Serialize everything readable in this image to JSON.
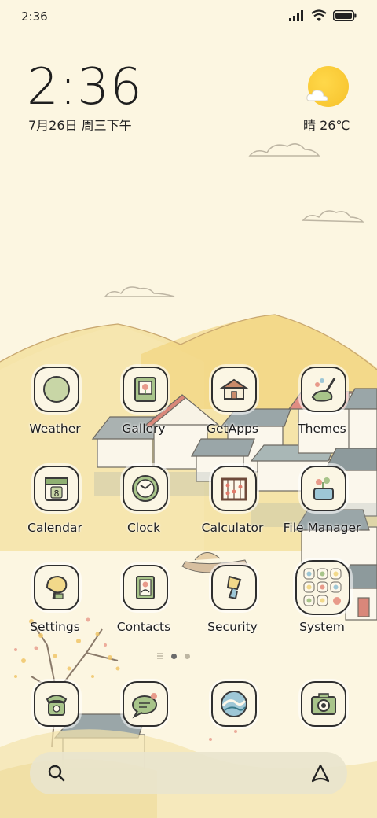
{
  "status_bar": {
    "time": "2:36"
  },
  "clock_widget": {
    "time": "2:36",
    "date": "7月26日 周三下午"
  },
  "weather_widget": {
    "condition_temp": "晴 26℃",
    "icon": "sun-cloud-icon"
  },
  "apps": [
    {
      "label": "Weather",
      "icon": "weather-icon"
    },
    {
      "label": "Gallery",
      "icon": "gallery-icon"
    },
    {
      "label": "GetApps",
      "icon": "getapps-icon"
    },
    {
      "label": "Themes",
      "icon": "themes-icon"
    },
    {
      "label": "Calendar",
      "icon": "calendar-icon"
    },
    {
      "label": "Clock",
      "icon": "clock-icon"
    },
    {
      "label": "Calculator",
      "icon": "calculator-icon"
    },
    {
      "label": "File Manager",
      "icon": "file-manager-icon"
    },
    {
      "label": "Settings",
      "icon": "settings-icon"
    },
    {
      "label": "Contacts",
      "icon": "contacts-icon"
    },
    {
      "label": "Security",
      "icon": "security-icon"
    },
    {
      "label": "System",
      "icon": "system-folder-icon"
    }
  ],
  "calendar_day": "8",
  "page_indicator": {
    "pages": 2,
    "current": 1
  },
  "dock": [
    {
      "icon": "phone-icon"
    },
    {
      "icon": "messages-icon"
    },
    {
      "icon": "browser-icon"
    },
    {
      "icon": "camera-icon"
    }
  ],
  "search_bar": {
    "left_icon": "search-icon",
    "right_icon": "assistant-icon"
  },
  "colors": {
    "background": "#fcf6e1",
    "sun": "#f6c12a",
    "mountain": "#f2d98a",
    "roof_red": "#d9877a",
    "roof_gray": "#9aa6a8"
  }
}
